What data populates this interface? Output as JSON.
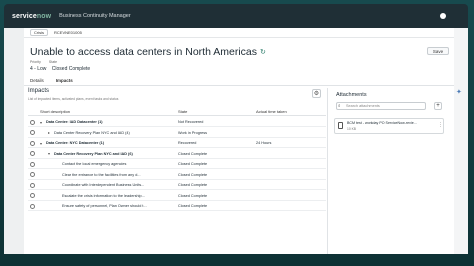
{
  "appbar": {
    "logo_main": "service",
    "logo_now": "now",
    "title": "Business Continuity Manager"
  },
  "crumbs": {
    "back_label": "Crisis",
    "record_id": "RCEVNE01005"
  },
  "record": {
    "title": "Unable to access data centers in North Americas",
    "save_label": "Save",
    "priority_label": "Priority",
    "state_label": "State",
    "priority_value": "4 - Low",
    "state_value": "Closed Complete"
  },
  "tabs": [
    {
      "label": "Details"
    },
    {
      "label": "Impacts"
    }
  ],
  "impacts": {
    "title": "Impacts",
    "subtitle": "List of impacted items, activated plans, event tasks and status",
    "columns": {
      "name": "Short description",
      "state": "State",
      "time": "Actual time taken"
    },
    "rows": [
      {
        "name": "Data Center: IAD Datacenter (1)",
        "state": "Not Recovered",
        "time": "",
        "bold": true,
        "indent": 0,
        "caret": "▾"
      },
      {
        "name": "Data Center Recovery Plan NYC and IAD (4)",
        "state": "Work in Progress",
        "time": "",
        "bold": false,
        "indent": 1,
        "caret": "▸"
      },
      {
        "name": "Data Center: NYC Datacenter (1)",
        "state": "Recovered",
        "time": "24 Hours",
        "bold": true,
        "indent": 0,
        "caret": "▾"
      },
      {
        "name": "Data Center Recovery Plan NYC and IAD (6)",
        "state": "Closed Complete",
        "time": "",
        "bold": true,
        "indent": 1,
        "caret": "▾"
      },
      {
        "name": "Contact the local emergency agencies",
        "state": "Closed Complete",
        "time": "",
        "bold": false,
        "indent": 2,
        "caret": ""
      },
      {
        "name": "Clear the entrance to the facilities from any d...",
        "state": "Closed Complete",
        "time": "",
        "bold": false,
        "indent": 2,
        "caret": ""
      },
      {
        "name": "Coordinate with Interdependent Business Units...",
        "state": "Closed Complete",
        "time": "",
        "bold": false,
        "indent": 2,
        "caret": ""
      },
      {
        "name": "Escalate the crisis information to the leadership...",
        "state": "Closed Complete",
        "time": "",
        "bold": false,
        "indent": 2,
        "caret": ""
      },
      {
        "name": "Ensure safety of personnel, Plan Owner should t...",
        "state": "Closed Complete",
        "time": "",
        "bold": false,
        "indent": 2,
        "caret": ""
      }
    ]
  },
  "attachments": {
    "title": "Attachments",
    "search_placeholder": "Search attachments",
    "file_name": "BCM test - workday PO ServiceNow-revie...",
    "file_size": "10 KB"
  },
  "colors": {
    "appbar": "#1f2f36",
    "background": "#0e3a3e",
    "accent": "#81b5a1"
  }
}
